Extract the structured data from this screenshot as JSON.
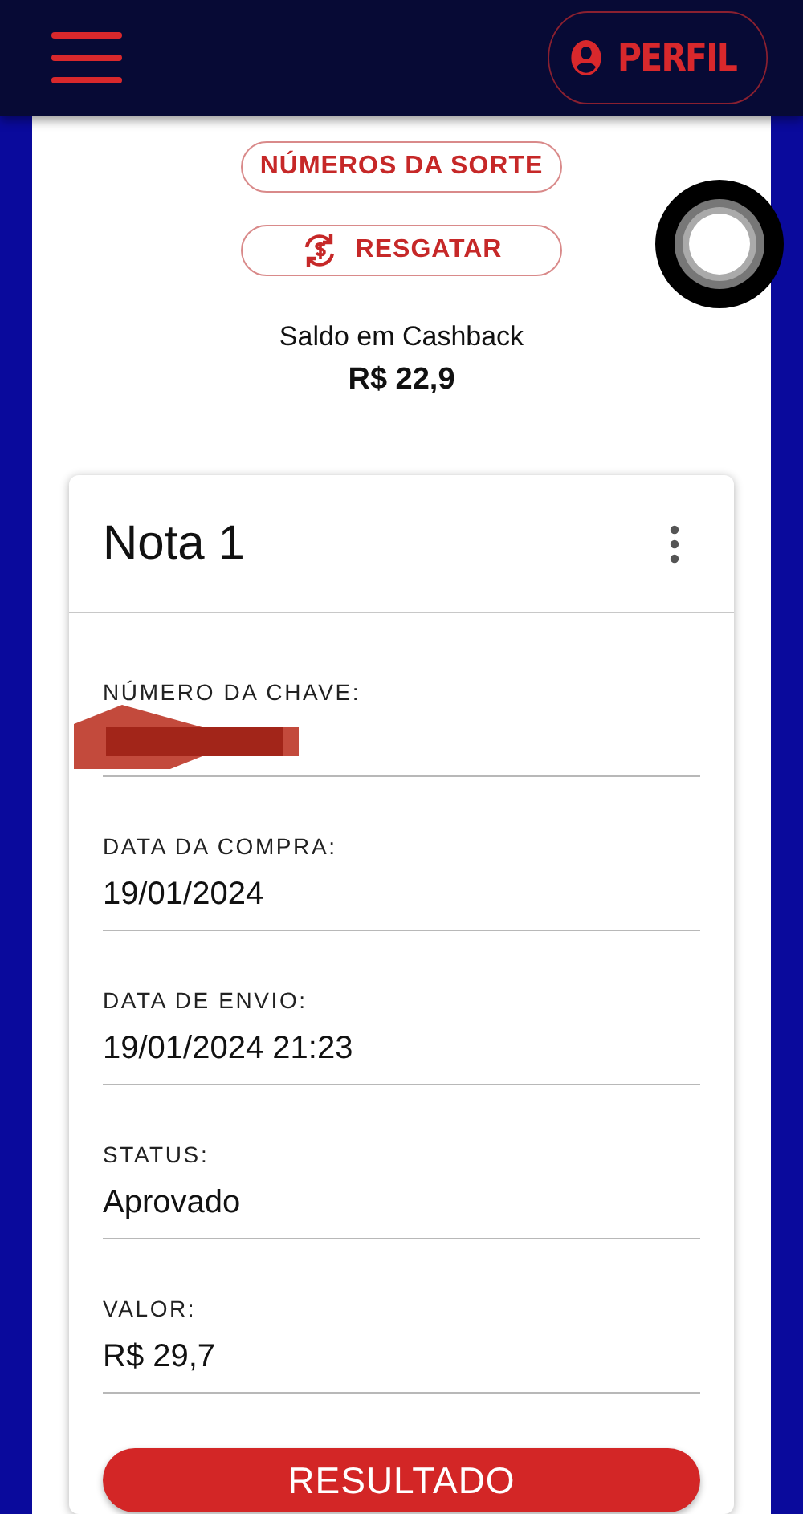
{
  "header": {
    "profile_button": "PERFIL"
  },
  "actions": [
    {
      "label": "NÚMEROS DA SORTE",
      "kind": "plain"
    },
    {
      "label": "RESGATAR",
      "kind": "icon"
    }
  ],
  "balance": {
    "label": "Saldo em Cashback",
    "value": "R$ 22,9"
  },
  "card": {
    "title": "Nota 1",
    "fields": [
      {
        "label": "NÚMERO DA CHAVE:",
        "redacted": true
      },
      {
        "label": "DATA DA COMPRA:",
        "value": "19/01/2024",
        "redacted": false
      },
      {
        "label": "DATA DE ENVIO:",
        "value": "19/01/2024 21:23",
        "redacted": false
      },
      {
        "label": "STATUS:",
        "value": "Aprovado",
        "redacted": false
      },
      {
        "label": "VALOR:",
        "value": "R$ 29,7",
        "redacted": false
      }
    ],
    "button": "RESULTADO"
  }
}
